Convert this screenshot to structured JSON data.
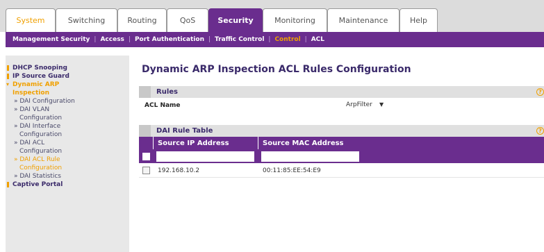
{
  "top_tabs": [
    {
      "label": "System",
      "state": "brand"
    },
    {
      "label": "Switching",
      "state": "normal"
    },
    {
      "label": "Routing",
      "state": "normal"
    },
    {
      "label": "QoS",
      "state": "normal"
    },
    {
      "label": "Security",
      "state": "active"
    },
    {
      "label": "Monitoring",
      "state": "normal"
    },
    {
      "label": "Maintenance",
      "state": "normal"
    },
    {
      "label": "Help",
      "state": "normal"
    }
  ],
  "sub_nav": [
    {
      "label": "Management Security"
    },
    {
      "label": "Access"
    },
    {
      "label": "Port Authentication"
    },
    {
      "label": "Traffic Control"
    },
    {
      "label": "Control",
      "current": true
    },
    {
      "label": "ACL"
    }
  ],
  "sidebar": [
    {
      "label": "DHCP Snooping",
      "level": "top"
    },
    {
      "label": "IP Source Guard",
      "level": "top"
    },
    {
      "label": "Dynamic ARP",
      "level": "open"
    },
    {
      "label": "Inspection",
      "level": "open-cont"
    },
    {
      "label": "» DAI Configuration",
      "level": "sub"
    },
    {
      "label": "» DAI VLAN",
      "level": "sub"
    },
    {
      "label": "Configuration",
      "level": "sub-cont"
    },
    {
      "label": "» DAI Interface",
      "level": "sub"
    },
    {
      "label": "Configuration",
      "level": "sub-cont"
    },
    {
      "label": "» DAI ACL",
      "level": "sub"
    },
    {
      "label": "Configuration",
      "level": "sub-cont"
    },
    {
      "label": "» DAI ACL Rule",
      "level": "sub-current"
    },
    {
      "label": "Configuration",
      "level": "sub-current-cont"
    },
    {
      "label": "» DAI Statistics",
      "level": "sub"
    },
    {
      "label": "Captive Portal",
      "level": "top"
    }
  ],
  "main": {
    "title": "Dynamic ARP Inspection ACL Rules Configuration",
    "rules_section": {
      "heading": "Rules",
      "acl_name_label": "ACL Name",
      "acl_name_value": "ArpFilter"
    },
    "table_section": {
      "heading": "DAI Rule Table",
      "columns": [
        "Source IP Address",
        "Source MAC Address"
      ],
      "rows": [
        {
          "ip": "192.168.10.2",
          "mac": "00:11:85:EE:54:E9"
        }
      ]
    },
    "help_glyph": "?"
  },
  "colors": {
    "brand_purple": "#6a2d8e",
    "accent_orange": "#f0a000",
    "text_navy": "#3a2a6a"
  }
}
